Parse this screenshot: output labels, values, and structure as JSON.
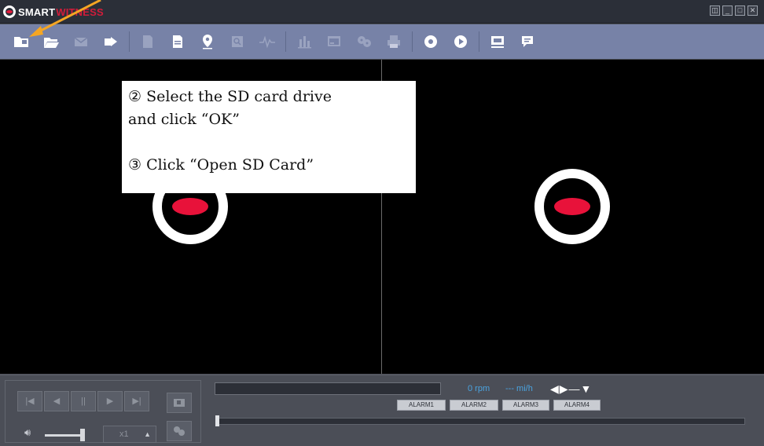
{
  "window": {
    "brand_part1": "SMART",
    "brand_part2": "WITNESS",
    "controls": [
      "◫",
      "_",
      "□",
      "✕"
    ]
  },
  "toolbar": {
    "icons": [
      "open-folder-icon",
      "open-sd-card-icon",
      "email-icon",
      "export-icon",
      "document-icon",
      "document-text-icon",
      "map-pin-icon",
      "search-document-icon",
      "waveform-icon",
      "chart-icon",
      "screen-window-icon",
      "film-reel-icon",
      "print-icon",
      "record-disc-icon",
      "play-circle-icon",
      "monitor-icon",
      "chat-bubble-icon"
    ]
  },
  "note": {
    "step2_line1": "② Select the SD card drive",
    "step2_line2": "and click “OK”",
    "step3": "③ Click “Open SD Card”"
  },
  "player": {
    "speed": "x1",
    "speed_arrow": "▲",
    "rpm": "0 rpm",
    "speed_unit": "--- mi/h",
    "direction_indicators": "◀▶—▼",
    "alarms": [
      "ALARM1",
      "ALARM2",
      "ALARM3",
      "ALARM4"
    ],
    "volume_level": 1.0
  },
  "colors": {
    "toolbar_bg": "#7782a7",
    "brand_red": "#e31b3b",
    "readout_blue": "#4aa3e0"
  }
}
